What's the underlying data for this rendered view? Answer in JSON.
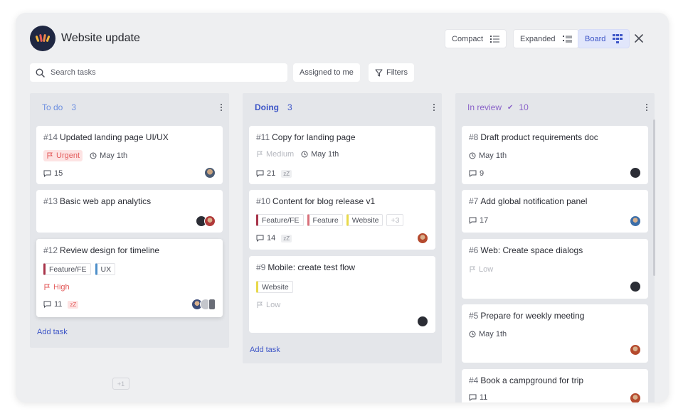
{
  "app": {
    "title": "Website update"
  },
  "views": {
    "compact": "Compact",
    "expanded": "Expanded",
    "board": "Board"
  },
  "search": {
    "placeholder": "Search tasks"
  },
  "filters": {
    "assigned": "Assigned to me",
    "filters": "Filters"
  },
  "colors": {
    "accent": "#3d55c7",
    "urgent": "#e35b5b",
    "todo": "#6d8fe0",
    "review": "#8a63c9"
  },
  "columns": [
    {
      "title": "To do",
      "count": "3",
      "add_label": "Add task",
      "cards": [
        {
          "num": "#14",
          "title": "Updated landing page UI/UX",
          "priority": "Urgent",
          "date": "May 1th",
          "comments": "15"
        },
        {
          "num": "#13",
          "title": "Basic web app analytics"
        },
        {
          "num": "#12",
          "title": "Review design for timeline",
          "tags": [
            "Feature/FE",
            "UX"
          ],
          "priority": "High",
          "comments": "11",
          "snooze": "zZ"
        }
      ]
    },
    {
      "title": "Doing",
      "count": "3",
      "add_label": "Add task",
      "cards": [
        {
          "num": "#11",
          "title": "Copy for landing page",
          "priority": "Medium",
          "date": "May 1th",
          "comments": "21",
          "snooze": "zZ"
        },
        {
          "num": "#10",
          "title": "Content for blog release v1",
          "tags": [
            "Feature/FE",
            "Feature",
            "Website"
          ],
          "more": "+3",
          "comments": "14",
          "snooze": "zZ"
        },
        {
          "num": "#9",
          "title": "Mobile: create test flow",
          "tags": [
            "Website"
          ],
          "priority": "Low"
        }
      ]
    },
    {
      "title": "In review",
      "check": "✔",
      "count": "10",
      "cards": [
        {
          "num": "#8",
          "title": "Draft product requirements doc",
          "date": "May 1th",
          "comments": "9"
        },
        {
          "num": "#7",
          "title": "Add global notification panel",
          "comments": "17"
        },
        {
          "num": "#6",
          "title": "Web: Create space dialogs",
          "priority": "Low"
        },
        {
          "num": "#5",
          "title": "Prepare for weekly meeting",
          "date": "May 1th"
        },
        {
          "num": "#4",
          "title": "Book a campground for trip",
          "comments": "11"
        }
      ]
    }
  ],
  "overflow_chip": "+1"
}
